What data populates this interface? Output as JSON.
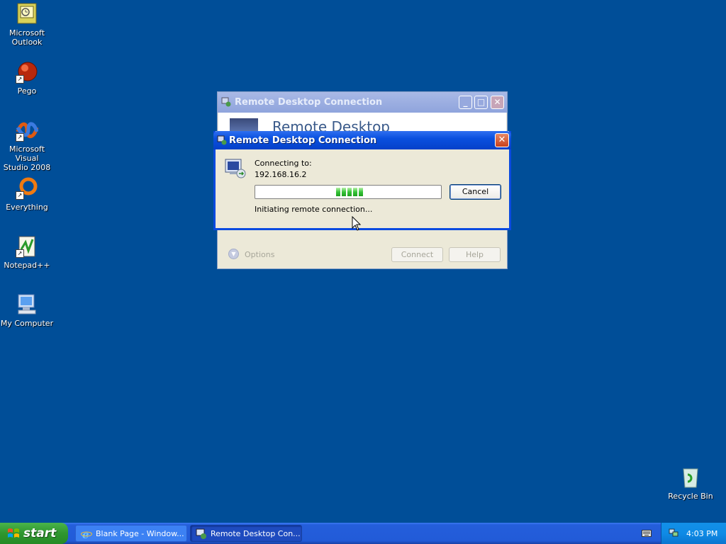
{
  "desktop": {
    "icons": [
      {
        "label": "Microsoft\nOutlook",
        "icon": "outlook-icon"
      },
      {
        "label": "Pego",
        "icon": "pego-icon"
      },
      {
        "label": "Microsoft Visual\nStudio 2008",
        "icon": "visual-studio-icon"
      },
      {
        "label": "Everything",
        "icon": "everything-icon"
      },
      {
        "label": "Notepad++",
        "icon": "notepadpp-icon"
      },
      {
        "label": "My Computer",
        "icon": "my-computer-icon"
      },
      {
        "label": "Recycle Bin",
        "icon": "recycle-bin-icon"
      }
    ]
  },
  "back_window": {
    "title": "Remote Desktop Connection",
    "banner_text": "Remote Desktop",
    "options_label": "Options",
    "connect_label": "Connect",
    "help_label": "Help"
  },
  "dialog": {
    "title": "Remote Desktop Connection",
    "connecting_label": "Connecting to:",
    "address": "192.168.16.2",
    "cancel_label": "Cancel",
    "status_text": "Initiating remote connection..."
  },
  "taskbar": {
    "start_label": "start",
    "tasks": [
      {
        "label": "Blank Page - Window...",
        "icon": "ie-icon"
      },
      {
        "label": "Remote Desktop Con...",
        "icon": "rdc-icon"
      }
    ],
    "clock": "4:03 PM"
  },
  "colors": {
    "desktop": "#004e98",
    "title_bar": "#0a50df",
    "progress_fill": "#37c43a",
    "start_button": "#2f962f"
  }
}
